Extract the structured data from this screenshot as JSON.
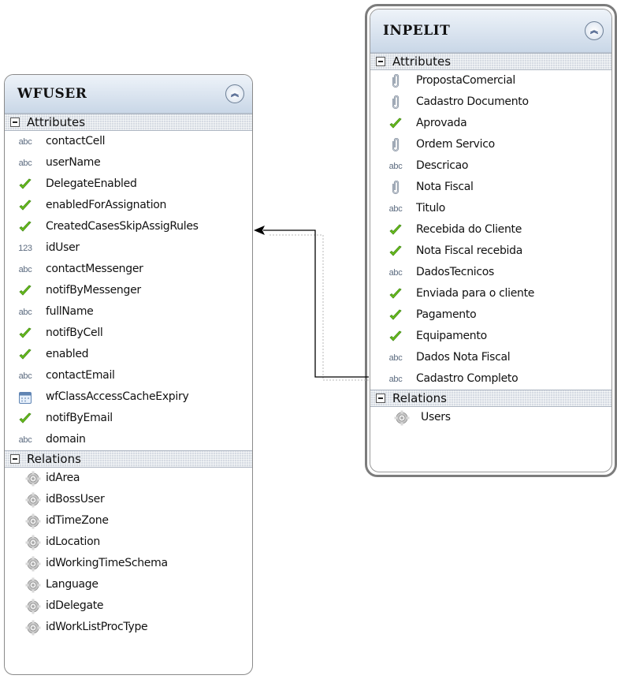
{
  "wfuser": {
    "title": "WFUSER",
    "attributes_label": "Attributes",
    "attributes": [
      {
        "name": "contactCell",
        "type": "abc"
      },
      {
        "name": "userName",
        "type": "abc"
      },
      {
        "name": "DelegateEnabled",
        "type": "check"
      },
      {
        "name": "enabledForAssignation",
        "type": "check"
      },
      {
        "name": "CreatedCasesSkipAssigRules",
        "type": "check"
      },
      {
        "name": "idUser",
        "type": "123"
      },
      {
        "name": "contactMessenger",
        "type": "abc"
      },
      {
        "name": "notifByMessenger",
        "type": "check"
      },
      {
        "name": "fullName",
        "type": "abc"
      },
      {
        "name": "notifByCell",
        "type": "check"
      },
      {
        "name": "enabled",
        "type": "check"
      },
      {
        "name": "contactEmail",
        "type": "abc"
      },
      {
        "name": "wfClassAccessCacheExpiry",
        "type": "date"
      },
      {
        "name": "notifByEmail",
        "type": "check"
      },
      {
        "name": "domain",
        "type": "abc"
      }
    ],
    "relations_label": "Relations",
    "relations": [
      "idArea",
      "idBossUser",
      "idTimeZone",
      "idLocation",
      "idWorkingTimeSchema",
      "Language",
      "idDelegate",
      "idWorkListProcType"
    ]
  },
  "inpelit": {
    "title": "INPELIT",
    "attributes_label": "Attributes",
    "attributes": [
      {
        "name": "PropostaComercial",
        "type": "file"
      },
      {
        "name": "Cadastro Documento",
        "type": "file"
      },
      {
        "name": "Aprovada",
        "type": "check"
      },
      {
        "name": "Ordem Servico",
        "type": "file"
      },
      {
        "name": "Descricao",
        "type": "abc"
      },
      {
        "name": "Nota Fiscal",
        "type": "file"
      },
      {
        "name": "Titulo",
        "type": "abc"
      },
      {
        "name": "Recebida do Cliente",
        "type": "check"
      },
      {
        "name": "Nota Fiscal recebida",
        "type": "check"
      },
      {
        "name": "DadosTecnicos",
        "type": "abc"
      },
      {
        "name": "Enviada para o cliente",
        "type": "check"
      },
      {
        "name": "Pagamento",
        "type": "check"
      },
      {
        "name": "Equipamento",
        "type": "check"
      },
      {
        "name": "Dados Nota Fiscal",
        "type": "abc"
      },
      {
        "name": "Cadastro Completo",
        "type": "abc"
      }
    ],
    "relations_label": "Relations",
    "relations": [
      "Users"
    ]
  },
  "colors": {
    "check": "#6cbf1e",
    "type_text": "#5d6c80",
    "connector": "#000000"
  }
}
